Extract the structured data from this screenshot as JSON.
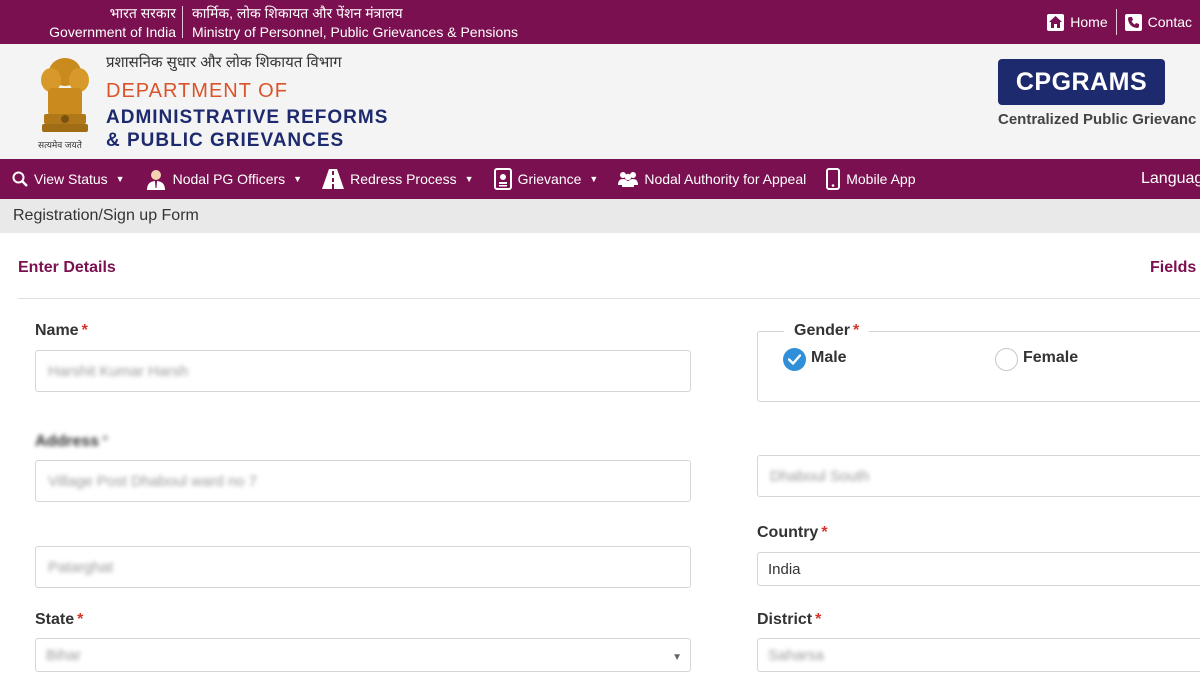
{
  "topbar": {
    "gov_hindi": "भारत सरकार",
    "gov_english": "Government of India",
    "ministry_hindi": "कार्मिक, लोक शिकायत और पेंशन मंत्रालय",
    "ministry_english": "Ministry of Personnel, Public Grievances & Pensions",
    "home_label": "Home",
    "contact_label": "Contac"
  },
  "header": {
    "emblem_motto": "सत्यमेव जयते",
    "dept_hindi": "प्रशासनिक सुधार और लोक शिकायत विभाग",
    "dept_line1": "DEPARTMENT OF",
    "dept_line2": "ADMINISTRATIVE REFORMS",
    "dept_line3": "& PUBLIC GRIEVANCES",
    "badge": "CPGRAMS",
    "badge_sub": "Centralized Public Grievanc"
  },
  "nav": {
    "items": [
      {
        "label": "View Status",
        "icon": "search-icon",
        "dropdown": true
      },
      {
        "label": "Nodal PG Officers",
        "icon": "officer-icon",
        "dropdown": true
      },
      {
        "label": "Redress Process",
        "icon": "road-icon",
        "dropdown": true
      },
      {
        "label": "Grievance",
        "icon": "document-icon",
        "dropdown": true
      },
      {
        "label": "Nodal Authority for Appeal",
        "icon": "users-icon",
        "dropdown": false
      },
      {
        "label": "Mobile App",
        "icon": "mobile-icon",
        "dropdown": false
      }
    ],
    "language": "Languag"
  },
  "breadcrumb": "Registration/Sign up Form",
  "form": {
    "section_title": "Enter Details",
    "section_right": "Fields",
    "name_label": "Name",
    "name_value": "Harshit Kumar Harsh",
    "address_label": "Address",
    "address_line1": "Village Post Dhaboul ward no 7",
    "address_line2": "Patarghat",
    "address_line3": "Dhaboul South",
    "gender_label": "Gender",
    "gender_male": "Male",
    "gender_female": "Female",
    "gender_selected": "Male",
    "country_label": "Country",
    "country_value": "India",
    "state_label": "State",
    "state_value": "Bihar",
    "district_label": "District",
    "district_value": "Saharsa",
    "required_mark": "*"
  },
  "colors": {
    "brand_maroon": "#7a1050",
    "dept_orange": "#d9542a",
    "dept_navy": "#1e2a6e",
    "radio_blue": "#2f8fd8",
    "required_red": "#d9342a"
  }
}
